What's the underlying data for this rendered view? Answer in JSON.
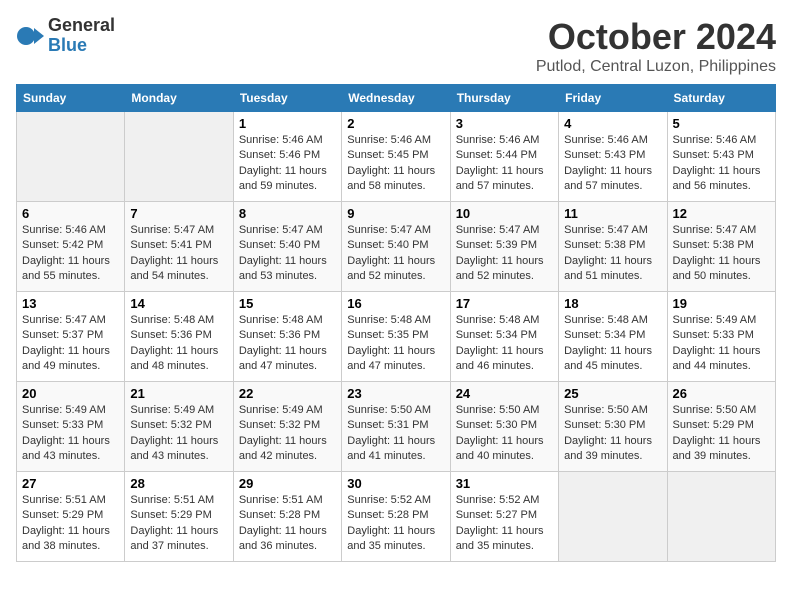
{
  "header": {
    "logo_line1": "General",
    "logo_line2": "Blue",
    "month": "October 2024",
    "location": "Putlod, Central Luzon, Philippines"
  },
  "days_of_week": [
    "Sunday",
    "Monday",
    "Tuesday",
    "Wednesday",
    "Thursday",
    "Friday",
    "Saturday"
  ],
  "weeks": [
    [
      {
        "day": "",
        "info": ""
      },
      {
        "day": "",
        "info": ""
      },
      {
        "day": "1",
        "sunrise": "Sunrise: 5:46 AM",
        "sunset": "Sunset: 5:46 PM",
        "daylight": "Daylight: 11 hours and 59 minutes."
      },
      {
        "day": "2",
        "sunrise": "Sunrise: 5:46 AM",
        "sunset": "Sunset: 5:45 PM",
        "daylight": "Daylight: 11 hours and 58 minutes."
      },
      {
        "day": "3",
        "sunrise": "Sunrise: 5:46 AM",
        "sunset": "Sunset: 5:44 PM",
        "daylight": "Daylight: 11 hours and 57 minutes."
      },
      {
        "day": "4",
        "sunrise": "Sunrise: 5:46 AM",
        "sunset": "Sunset: 5:43 PM",
        "daylight": "Daylight: 11 hours and 57 minutes."
      },
      {
        "day": "5",
        "sunrise": "Sunrise: 5:46 AM",
        "sunset": "Sunset: 5:43 PM",
        "daylight": "Daylight: 11 hours and 56 minutes."
      }
    ],
    [
      {
        "day": "6",
        "sunrise": "Sunrise: 5:46 AM",
        "sunset": "Sunset: 5:42 PM",
        "daylight": "Daylight: 11 hours and 55 minutes."
      },
      {
        "day": "7",
        "sunrise": "Sunrise: 5:47 AM",
        "sunset": "Sunset: 5:41 PM",
        "daylight": "Daylight: 11 hours and 54 minutes."
      },
      {
        "day": "8",
        "sunrise": "Sunrise: 5:47 AM",
        "sunset": "Sunset: 5:40 PM",
        "daylight": "Daylight: 11 hours and 53 minutes."
      },
      {
        "day": "9",
        "sunrise": "Sunrise: 5:47 AM",
        "sunset": "Sunset: 5:40 PM",
        "daylight": "Daylight: 11 hours and 52 minutes."
      },
      {
        "day": "10",
        "sunrise": "Sunrise: 5:47 AM",
        "sunset": "Sunset: 5:39 PM",
        "daylight": "Daylight: 11 hours and 52 minutes."
      },
      {
        "day": "11",
        "sunrise": "Sunrise: 5:47 AM",
        "sunset": "Sunset: 5:38 PM",
        "daylight": "Daylight: 11 hours and 51 minutes."
      },
      {
        "day": "12",
        "sunrise": "Sunrise: 5:47 AM",
        "sunset": "Sunset: 5:38 PM",
        "daylight": "Daylight: 11 hours and 50 minutes."
      }
    ],
    [
      {
        "day": "13",
        "sunrise": "Sunrise: 5:47 AM",
        "sunset": "Sunset: 5:37 PM",
        "daylight": "Daylight: 11 hours and 49 minutes."
      },
      {
        "day": "14",
        "sunrise": "Sunrise: 5:48 AM",
        "sunset": "Sunset: 5:36 PM",
        "daylight": "Daylight: 11 hours and 48 minutes."
      },
      {
        "day": "15",
        "sunrise": "Sunrise: 5:48 AM",
        "sunset": "Sunset: 5:36 PM",
        "daylight": "Daylight: 11 hours and 47 minutes."
      },
      {
        "day": "16",
        "sunrise": "Sunrise: 5:48 AM",
        "sunset": "Sunset: 5:35 PM",
        "daylight": "Daylight: 11 hours and 47 minutes."
      },
      {
        "day": "17",
        "sunrise": "Sunrise: 5:48 AM",
        "sunset": "Sunset: 5:34 PM",
        "daylight": "Daylight: 11 hours and 46 minutes."
      },
      {
        "day": "18",
        "sunrise": "Sunrise: 5:48 AM",
        "sunset": "Sunset: 5:34 PM",
        "daylight": "Daylight: 11 hours and 45 minutes."
      },
      {
        "day": "19",
        "sunrise": "Sunrise: 5:49 AM",
        "sunset": "Sunset: 5:33 PM",
        "daylight": "Daylight: 11 hours and 44 minutes."
      }
    ],
    [
      {
        "day": "20",
        "sunrise": "Sunrise: 5:49 AM",
        "sunset": "Sunset: 5:33 PM",
        "daylight": "Daylight: 11 hours and 43 minutes."
      },
      {
        "day": "21",
        "sunrise": "Sunrise: 5:49 AM",
        "sunset": "Sunset: 5:32 PM",
        "daylight": "Daylight: 11 hours and 43 minutes."
      },
      {
        "day": "22",
        "sunrise": "Sunrise: 5:49 AM",
        "sunset": "Sunset: 5:32 PM",
        "daylight": "Daylight: 11 hours and 42 minutes."
      },
      {
        "day": "23",
        "sunrise": "Sunrise: 5:50 AM",
        "sunset": "Sunset: 5:31 PM",
        "daylight": "Daylight: 11 hours and 41 minutes."
      },
      {
        "day": "24",
        "sunrise": "Sunrise: 5:50 AM",
        "sunset": "Sunset: 5:30 PM",
        "daylight": "Daylight: 11 hours and 40 minutes."
      },
      {
        "day": "25",
        "sunrise": "Sunrise: 5:50 AM",
        "sunset": "Sunset: 5:30 PM",
        "daylight": "Daylight: 11 hours and 39 minutes."
      },
      {
        "day": "26",
        "sunrise": "Sunrise: 5:50 AM",
        "sunset": "Sunset: 5:29 PM",
        "daylight": "Daylight: 11 hours and 39 minutes."
      }
    ],
    [
      {
        "day": "27",
        "sunrise": "Sunrise: 5:51 AM",
        "sunset": "Sunset: 5:29 PM",
        "daylight": "Daylight: 11 hours and 38 minutes."
      },
      {
        "day": "28",
        "sunrise": "Sunrise: 5:51 AM",
        "sunset": "Sunset: 5:29 PM",
        "daylight": "Daylight: 11 hours and 37 minutes."
      },
      {
        "day": "29",
        "sunrise": "Sunrise: 5:51 AM",
        "sunset": "Sunset: 5:28 PM",
        "daylight": "Daylight: 11 hours and 36 minutes."
      },
      {
        "day": "30",
        "sunrise": "Sunrise: 5:52 AM",
        "sunset": "Sunset: 5:28 PM",
        "daylight": "Daylight: 11 hours and 35 minutes."
      },
      {
        "day": "31",
        "sunrise": "Sunrise: 5:52 AM",
        "sunset": "Sunset: 5:27 PM",
        "daylight": "Daylight: 11 hours and 35 minutes."
      },
      {
        "day": "",
        "info": ""
      },
      {
        "day": "",
        "info": ""
      }
    ]
  ]
}
